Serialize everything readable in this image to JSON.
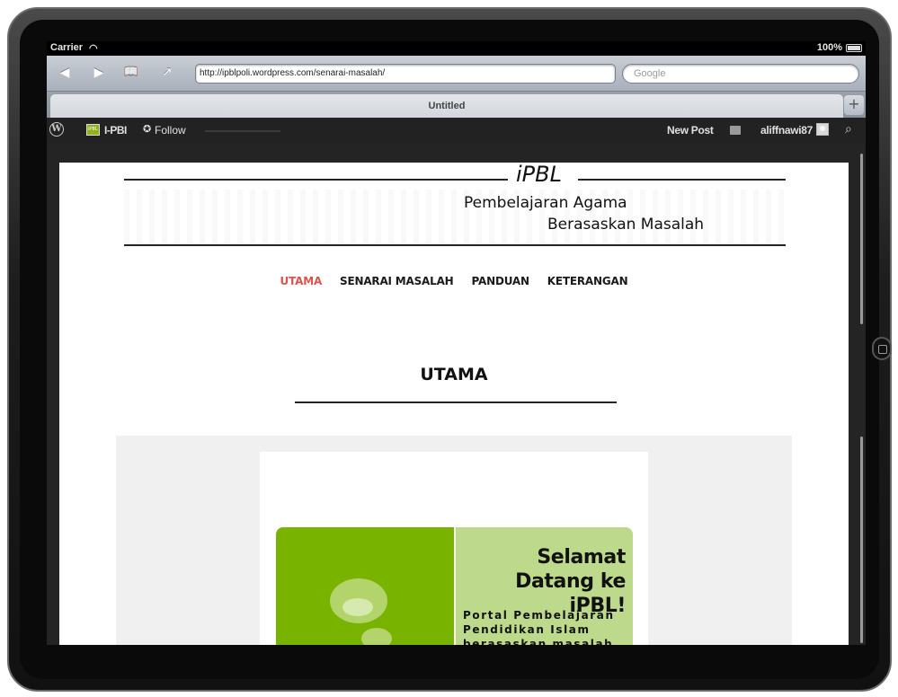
{
  "status_bar": {
    "carrier": "Carrier",
    "battery": "100%"
  },
  "toolbar": {
    "url": "http://ipblpoli.wordpress.com/senarai-masalah/",
    "search_placeholder": "Google"
  },
  "tabs": {
    "active_title": "Untitled",
    "new_tab": "+"
  },
  "admin_bar": {
    "site_name": "I-PBI",
    "follow": "Follow",
    "new_post": "New Post",
    "username": "aliffnawi87"
  },
  "site": {
    "title": "iPBL",
    "tagline_1": "Pembelajaran Agama",
    "tagline_2": "Berasaskan Masalah"
  },
  "nav": {
    "items": [
      "UTAMA",
      "SENARAI MASALAH",
      "PANDUAN",
      "KETERANGAN"
    ]
  },
  "page": {
    "title": "UTAMA"
  },
  "banner": {
    "heading_1": "Selamat",
    "heading_2": "Datang ke iPBL!",
    "text": "Portal Pembelajaran Pendidikan Islam berasaskan masalah"
  },
  "colors": {
    "nav_active": "#d9534f",
    "banner_green": "#78b300",
    "banner_light_green": "#bcd98c",
    "admin_bar": "#222222"
  },
  "icons": [
    "wifi-icon",
    "battery-icon",
    "back-icon",
    "forward-icon",
    "bookmarks-icon",
    "share-icon",
    "wordpress-icon",
    "site-icon",
    "follow-icon",
    "comment-icon",
    "avatar",
    "search-icon",
    "home-button"
  ]
}
